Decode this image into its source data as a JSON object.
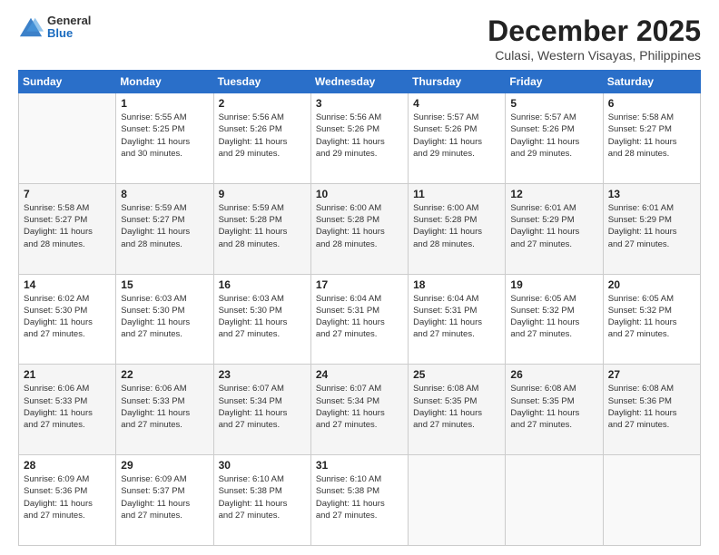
{
  "logo": {
    "general": "General",
    "blue": "Blue"
  },
  "title": "December 2025",
  "subtitle": "Culasi, Western Visayas, Philippines",
  "weekdays": [
    "Sunday",
    "Monday",
    "Tuesday",
    "Wednesday",
    "Thursday",
    "Friday",
    "Saturday"
  ],
  "weeks": [
    [
      {
        "day": "",
        "info": ""
      },
      {
        "day": "1",
        "info": "Sunrise: 5:55 AM\nSunset: 5:25 PM\nDaylight: 11 hours\nand 30 minutes."
      },
      {
        "day": "2",
        "info": "Sunrise: 5:56 AM\nSunset: 5:26 PM\nDaylight: 11 hours\nand 29 minutes."
      },
      {
        "day": "3",
        "info": "Sunrise: 5:56 AM\nSunset: 5:26 PM\nDaylight: 11 hours\nand 29 minutes."
      },
      {
        "day": "4",
        "info": "Sunrise: 5:57 AM\nSunset: 5:26 PM\nDaylight: 11 hours\nand 29 minutes."
      },
      {
        "day": "5",
        "info": "Sunrise: 5:57 AM\nSunset: 5:26 PM\nDaylight: 11 hours\nand 29 minutes."
      },
      {
        "day": "6",
        "info": "Sunrise: 5:58 AM\nSunset: 5:27 PM\nDaylight: 11 hours\nand 28 minutes."
      }
    ],
    [
      {
        "day": "7",
        "info": "Sunrise: 5:58 AM\nSunset: 5:27 PM\nDaylight: 11 hours\nand 28 minutes."
      },
      {
        "day": "8",
        "info": "Sunrise: 5:59 AM\nSunset: 5:27 PM\nDaylight: 11 hours\nand 28 minutes."
      },
      {
        "day": "9",
        "info": "Sunrise: 5:59 AM\nSunset: 5:28 PM\nDaylight: 11 hours\nand 28 minutes."
      },
      {
        "day": "10",
        "info": "Sunrise: 6:00 AM\nSunset: 5:28 PM\nDaylight: 11 hours\nand 28 minutes."
      },
      {
        "day": "11",
        "info": "Sunrise: 6:00 AM\nSunset: 5:28 PM\nDaylight: 11 hours\nand 28 minutes."
      },
      {
        "day": "12",
        "info": "Sunrise: 6:01 AM\nSunset: 5:29 PM\nDaylight: 11 hours\nand 27 minutes."
      },
      {
        "day": "13",
        "info": "Sunrise: 6:01 AM\nSunset: 5:29 PM\nDaylight: 11 hours\nand 27 minutes."
      }
    ],
    [
      {
        "day": "14",
        "info": "Sunrise: 6:02 AM\nSunset: 5:30 PM\nDaylight: 11 hours\nand 27 minutes."
      },
      {
        "day": "15",
        "info": "Sunrise: 6:03 AM\nSunset: 5:30 PM\nDaylight: 11 hours\nand 27 minutes."
      },
      {
        "day": "16",
        "info": "Sunrise: 6:03 AM\nSunset: 5:30 PM\nDaylight: 11 hours\nand 27 minutes."
      },
      {
        "day": "17",
        "info": "Sunrise: 6:04 AM\nSunset: 5:31 PM\nDaylight: 11 hours\nand 27 minutes."
      },
      {
        "day": "18",
        "info": "Sunrise: 6:04 AM\nSunset: 5:31 PM\nDaylight: 11 hours\nand 27 minutes."
      },
      {
        "day": "19",
        "info": "Sunrise: 6:05 AM\nSunset: 5:32 PM\nDaylight: 11 hours\nand 27 minutes."
      },
      {
        "day": "20",
        "info": "Sunrise: 6:05 AM\nSunset: 5:32 PM\nDaylight: 11 hours\nand 27 minutes."
      }
    ],
    [
      {
        "day": "21",
        "info": "Sunrise: 6:06 AM\nSunset: 5:33 PM\nDaylight: 11 hours\nand 27 minutes."
      },
      {
        "day": "22",
        "info": "Sunrise: 6:06 AM\nSunset: 5:33 PM\nDaylight: 11 hours\nand 27 minutes."
      },
      {
        "day": "23",
        "info": "Sunrise: 6:07 AM\nSunset: 5:34 PM\nDaylight: 11 hours\nand 27 minutes."
      },
      {
        "day": "24",
        "info": "Sunrise: 6:07 AM\nSunset: 5:34 PM\nDaylight: 11 hours\nand 27 minutes."
      },
      {
        "day": "25",
        "info": "Sunrise: 6:08 AM\nSunset: 5:35 PM\nDaylight: 11 hours\nand 27 minutes."
      },
      {
        "day": "26",
        "info": "Sunrise: 6:08 AM\nSunset: 5:35 PM\nDaylight: 11 hours\nand 27 minutes."
      },
      {
        "day": "27",
        "info": "Sunrise: 6:08 AM\nSunset: 5:36 PM\nDaylight: 11 hours\nand 27 minutes."
      }
    ],
    [
      {
        "day": "28",
        "info": "Sunrise: 6:09 AM\nSunset: 5:36 PM\nDaylight: 11 hours\nand 27 minutes."
      },
      {
        "day": "29",
        "info": "Sunrise: 6:09 AM\nSunset: 5:37 PM\nDaylight: 11 hours\nand 27 minutes."
      },
      {
        "day": "30",
        "info": "Sunrise: 6:10 AM\nSunset: 5:38 PM\nDaylight: 11 hours\nand 27 minutes."
      },
      {
        "day": "31",
        "info": "Sunrise: 6:10 AM\nSunset: 5:38 PM\nDaylight: 11 hours\nand 27 minutes."
      },
      {
        "day": "",
        "info": ""
      },
      {
        "day": "",
        "info": ""
      },
      {
        "day": "",
        "info": ""
      }
    ]
  ]
}
